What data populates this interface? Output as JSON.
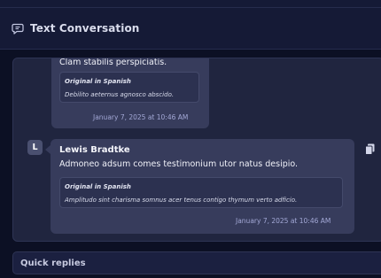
{
  "header": {
    "title": "Text Conversation",
    "icon": "message-icon"
  },
  "messages": [
    {
      "body": "Clam stabilis perspiciatis.",
      "original_label": "Original in Spanish",
      "original_text": "Debilito aeternus agnosco abscido.",
      "timestamp": "January 7, 2025 at 10:46 AM"
    },
    {
      "avatar_initial": "L",
      "sender": "Lewis Bradtke",
      "body": "Admoneo adsum comes testimonium utor natus desipio.",
      "original_label": "Original in Spanish",
      "original_text": "Amplitudo sint charisma somnus acer tenus contigo thymum verto adficio.",
      "timestamp": "January 7, 2025 at 10:46 AM"
    }
  ],
  "actions": {
    "copy_icon": "copy-icon"
  },
  "quick_replies": {
    "label": "Quick replies"
  }
}
